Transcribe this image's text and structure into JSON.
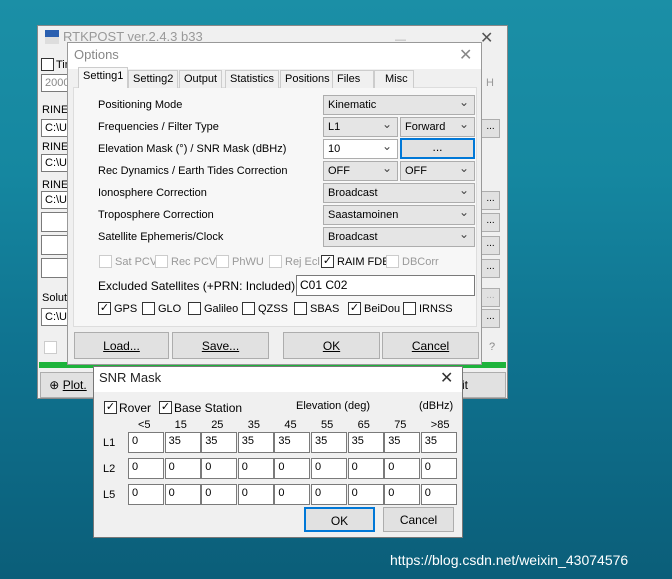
{
  "main_window": {
    "title": "RTKPOST ver.2.4.3 b33",
    "time_start": "Tim",
    "date": "2000/",
    "h": "H",
    "rinex": [
      "RINEX",
      "RINEX",
      "RINEX"
    ],
    "paths": [
      "C:\\Us",
      "C:\\Us",
      "C:\\Us"
    ],
    "solution": "Solutic",
    "solution_path": "C:\\Us",
    "help": "?",
    "plot": "Plot.",
    "exit": "xit",
    "dots": "...",
    "progress": 100,
    "progress_color": "#1db33b"
  },
  "options": {
    "title": "Options",
    "tabs": [
      "Setting1",
      "Setting2",
      "Output",
      "Statistics",
      "Positions",
      "Files",
      "Misc"
    ],
    "rows": [
      {
        "label": "Positioning Mode",
        "value": "Kinematic"
      },
      {
        "label": "Frequencies / Filter Type",
        "value": "L1",
        "value2": "Forward"
      },
      {
        "label": "Elevation Mask (°) / SNR Mask (dBHz)",
        "value": "10",
        "button": "..."
      },
      {
        "label": "Rec Dynamics / Earth Tides Correction",
        "value": "OFF",
        "value2": "OFF"
      },
      {
        "label": "Ionosphere Correction",
        "value": "Broadcast"
      },
      {
        "label": "Troposphere Correction",
        "value": "Saastamoinen"
      },
      {
        "label": "Satellite Ephemeris/Clock",
        "value": "Broadcast"
      }
    ],
    "opts": [
      {
        "label": "Sat PCV",
        "checked": false,
        "enabled": false
      },
      {
        "label": "Rec PCV",
        "checked": false,
        "enabled": false
      },
      {
        "label": "PhWU",
        "checked": false,
        "enabled": false
      },
      {
        "label": "Rej Ecl",
        "checked": false,
        "enabled": false
      },
      {
        "label": "RAIM FDE",
        "checked": true,
        "enabled": true
      },
      {
        "label": "DBCorr",
        "checked": false,
        "enabled": false
      }
    ],
    "excluded_label": "Excluded Satellites (+PRN: Included)",
    "excluded_value": "C01 C02",
    "systems": [
      {
        "label": "GPS",
        "checked": true
      },
      {
        "label": "GLO",
        "checked": false
      },
      {
        "label": "Galileo",
        "checked": false
      },
      {
        "label": "QZSS",
        "checked": false
      },
      {
        "label": "SBAS",
        "checked": false
      },
      {
        "label": "BeiDou",
        "checked": true
      },
      {
        "label": "IRNSS",
        "checked": false
      }
    ],
    "buttons": {
      "load": "Load...",
      "save": "Save...",
      "ok": "OK",
      "cancel": "Cancel"
    }
  },
  "snr": {
    "title": "SNR Mask",
    "rover": "Rover",
    "base": "Base Station",
    "rover_checked": true,
    "base_checked": true,
    "elev_label": "Elevation (deg)",
    "unit": "(dBHz)",
    "cols": [
      "<5",
      "15",
      "25",
      "35",
      "45",
      "55",
      "65",
      "75",
      ">85"
    ],
    "rows": [
      {
        "label": "L1",
        "values": [
          "0",
          "35",
          "35",
          "35",
          "35",
          "35",
          "35",
          "35",
          "35"
        ]
      },
      {
        "label": "L2",
        "values": [
          "0",
          "0",
          "0",
          "0",
          "0",
          "0",
          "0",
          "0",
          "0"
        ]
      },
      {
        "label": "L5",
        "values": [
          "0",
          "0",
          "0",
          "0",
          "0",
          "0",
          "0",
          "0",
          "0"
        ]
      }
    ],
    "ok": "OK",
    "cancel": "Cancel"
  },
  "watermark": "https://blog.csdn.net/weixin_43074576"
}
